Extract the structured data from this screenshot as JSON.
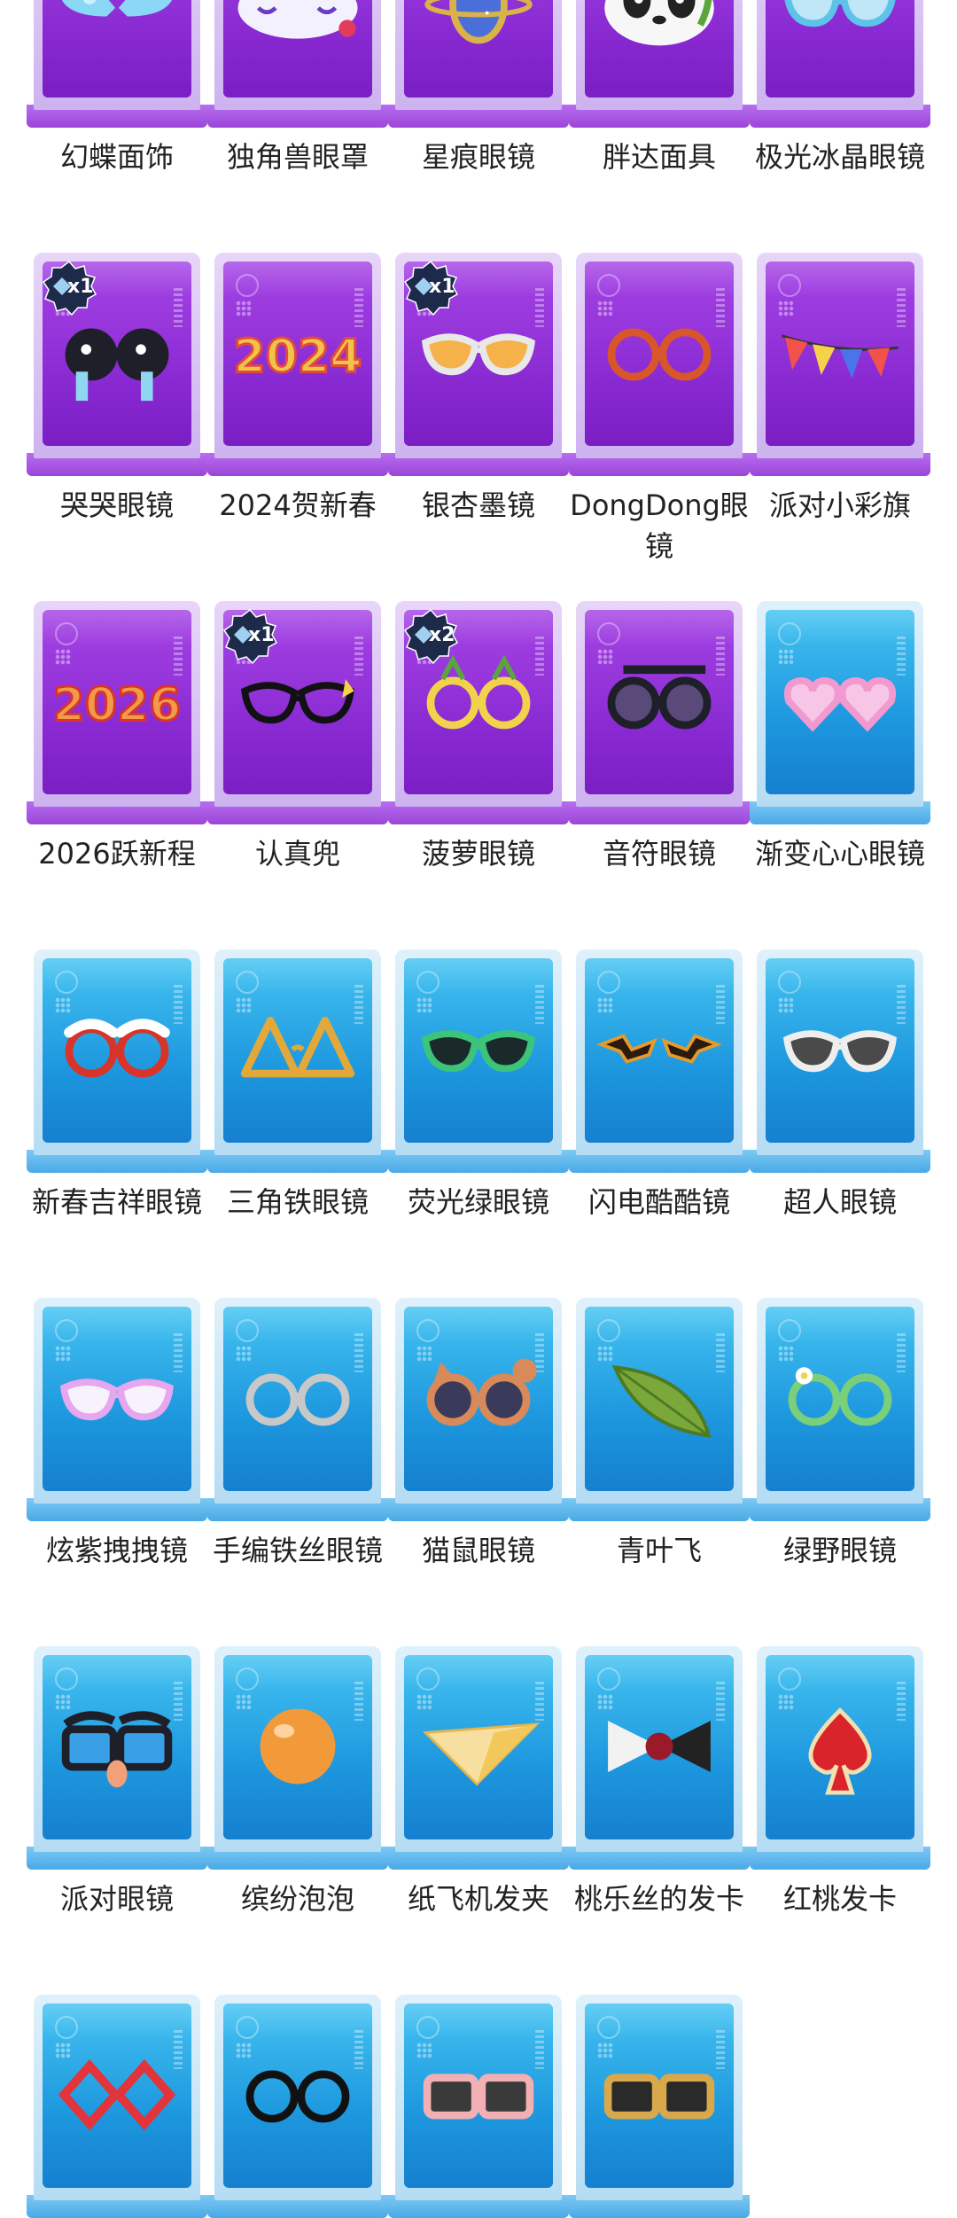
{
  "items": [
    {
      "name": "幻蝶面饰",
      "theme": "purple",
      "icon": "butterfly-mask-icon",
      "badge": ""
    },
    {
      "name": "独角兽眼罩",
      "theme": "purple",
      "icon": "unicorn-sleep-mask-icon",
      "badge": ""
    },
    {
      "name": "星痕眼镜",
      "theme": "purple",
      "icon": "planet-monocle-icon",
      "badge": ""
    },
    {
      "name": "胖达面具",
      "theme": "purple",
      "icon": "panda-mask-icon",
      "badge": ""
    },
    {
      "name": "极光冰晶眼镜",
      "theme": "purple",
      "icon": "ice-crystal-glasses-icon",
      "badge": ""
    },
    {
      "name": "哭哭眼镜",
      "theme": "purple",
      "icon": "crying-glasses-icon",
      "badge": "x1"
    },
    {
      "name": "2024贺新春",
      "theme": "purple",
      "icon": "2024-glasses-icon",
      "badge": ""
    },
    {
      "name": "银杏墨镜",
      "theme": "purple",
      "icon": "gingko-sunglasses-icon",
      "badge": "x1"
    },
    {
      "name": "DongDong眼镜",
      "theme": "purple",
      "icon": "round-glasses-icon",
      "badge": ""
    },
    {
      "name": "派对小彩旗",
      "theme": "purple",
      "icon": "bunting-flags-icon",
      "badge": ""
    },
    {
      "name": "2026跃新程",
      "theme": "purple",
      "icon": "2026-glasses-icon",
      "badge": ""
    },
    {
      "name": "认真兜",
      "theme": "purple",
      "icon": "black-cateye-glasses-icon",
      "badge": "x1"
    },
    {
      "name": "菠萝眼镜",
      "theme": "purple",
      "icon": "pineapple-glasses-icon",
      "badge": "x2"
    },
    {
      "name": "音符眼镜",
      "theme": "purple",
      "icon": "music-note-glasses-icon",
      "badge": ""
    },
    {
      "name": "渐变心心眼镜",
      "theme": "blue",
      "icon": "heart-glasses-icon",
      "badge": ""
    },
    {
      "name": "新春吉祥眼镜",
      "theme": "blue",
      "icon": "snow-red-glasses-icon",
      "badge": ""
    },
    {
      "name": "三角铁眼镜",
      "theme": "blue",
      "icon": "triangle-glasses-icon",
      "badge": ""
    },
    {
      "name": "荧光绿眼镜",
      "theme": "blue",
      "icon": "green-camo-glasses-icon",
      "badge": ""
    },
    {
      "name": "闪电酷酷镜",
      "theme": "blue",
      "icon": "lightning-glasses-icon",
      "badge": ""
    },
    {
      "name": "超人眼镜",
      "theme": "blue",
      "icon": "white-cateye-glasses-icon",
      "badge": ""
    },
    {
      "name": "炫紫拽拽镜",
      "theme": "blue",
      "icon": "purple-glasses-icon",
      "badge": ""
    },
    {
      "name": "手编铁丝眼镜",
      "theme": "blue",
      "icon": "wire-glasses-icon",
      "badge": ""
    },
    {
      "name": "猫鼠眼镜",
      "theme": "blue",
      "icon": "cat-mouse-glasses-icon",
      "badge": ""
    },
    {
      "name": "青叶飞",
      "theme": "blue",
      "icon": "leaf-icon",
      "badge": ""
    },
    {
      "name": "绿野眼镜",
      "theme": "blue",
      "icon": "green-flower-glasses-icon",
      "badge": ""
    },
    {
      "name": "派对眼镜",
      "theme": "blue",
      "icon": "party-nose-glasses-icon",
      "badge": ""
    },
    {
      "name": "缤纷泡泡",
      "theme": "blue",
      "icon": "orange-bubble-icon",
      "badge": ""
    },
    {
      "name": "纸飞机发夹",
      "theme": "blue",
      "icon": "paper-plane-clip-icon",
      "badge": ""
    },
    {
      "name": "桃乐丝的发卡",
      "theme": "blue",
      "icon": "bow-hairpin-icon",
      "badge": ""
    },
    {
      "name": "红桃发卡",
      "theme": "blue",
      "icon": "spade-hairpin-icon",
      "badge": ""
    },
    {
      "name": "",
      "theme": "blue",
      "icon": "red-diamond-glasses-icon",
      "badge": ""
    },
    {
      "name": "",
      "theme": "blue",
      "icon": "black-round-glasses-icon",
      "badge": ""
    },
    {
      "name": "",
      "theme": "blue",
      "icon": "pink-sunglasses-icon",
      "badge": ""
    },
    {
      "name": "",
      "theme": "blue",
      "icon": "black-square-sunglasses-icon",
      "badge": ""
    }
  ],
  "colors": {
    "purple_card": "#8f2fd6",
    "blue_card": "#1d97de",
    "badge_bg": "#1e2a4a",
    "label_text": "#222222"
  }
}
